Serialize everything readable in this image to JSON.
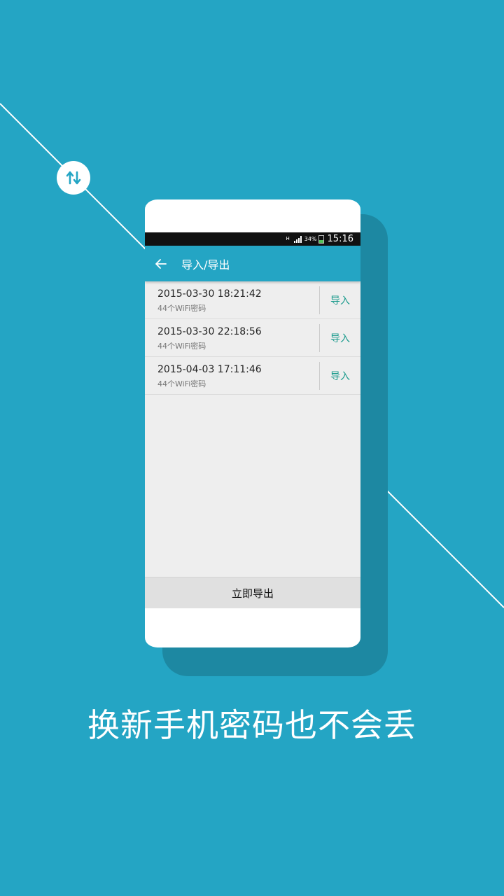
{
  "colors": {
    "background": "#24a5c4",
    "app_bar": "#24a5c4",
    "accent_text": "#199a8c",
    "shadow": "#1d88a2"
  },
  "decor": {
    "badge_icon": "swap-vertical-icon"
  },
  "status_bar": {
    "network": "H",
    "battery_percent": "34%",
    "time": "15:16"
  },
  "app_bar": {
    "back_icon": "arrow-left-icon",
    "title": "导入/导出"
  },
  "records": [
    {
      "date": "2015-03-30 18:21:42",
      "summary": "44个WiFi密码",
      "action": "导入"
    },
    {
      "date": "2015-03-30 22:18:56",
      "summary": "44个WiFi密码",
      "action": "导入"
    },
    {
      "date": "2015-04-03 17:11:46",
      "summary": "44个WiFi密码",
      "action": "导入"
    }
  ],
  "export_button": {
    "label": "立即导出"
  },
  "caption": "换新手机密码也不会丢"
}
